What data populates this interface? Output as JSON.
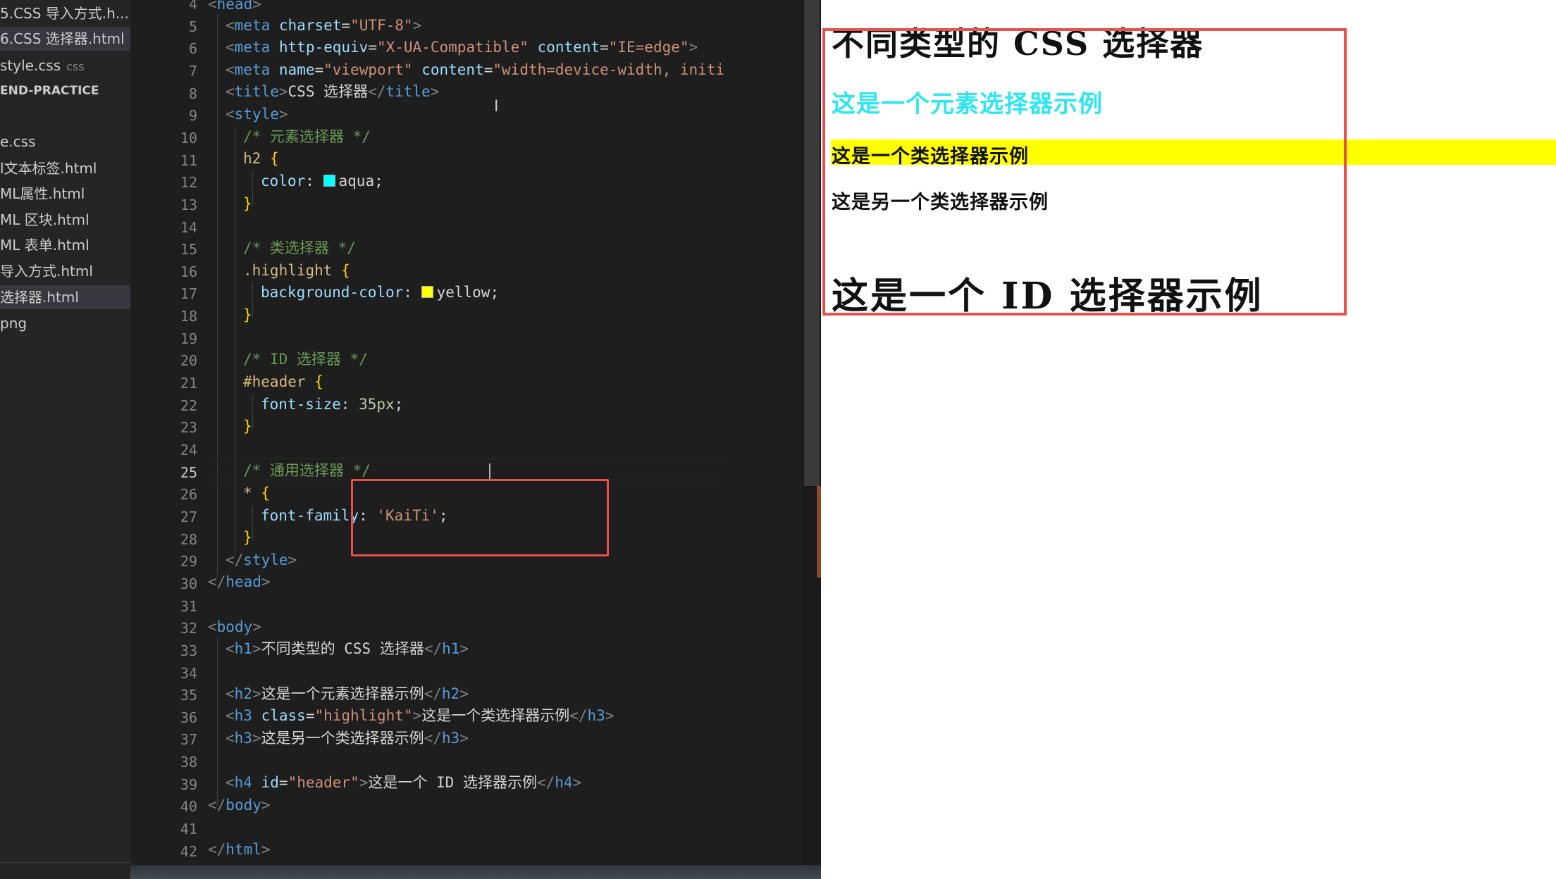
{
  "explorer": {
    "items": [
      {
        "label": "5.CSS 导入方式.h..."
      },
      {
        "label": "6.CSS 选择器.html"
      },
      {
        "label": "style.css",
        "ext": "css"
      },
      {
        "label": "END-PRACTICE"
      },
      {
        "label": "e.css"
      },
      {
        "label": "l文本标签.html"
      },
      {
        "label": "ML属性.html"
      },
      {
        "label": "ML 区块.html"
      },
      {
        "label": "ML 表单.html"
      },
      {
        "label": "导入方式.html"
      },
      {
        "label": "选择器.html"
      },
      {
        "label": "png"
      }
    ]
  },
  "editor": {
    "line_numbers": [
      "4",
      "5",
      "6",
      "7",
      "8",
      "9",
      "10",
      "11",
      "12",
      "13",
      "14",
      "15",
      "16",
      "17",
      "18",
      "19",
      "20",
      "21",
      "22",
      "23",
      "24",
      "25",
      "26",
      "27",
      "28",
      "29",
      "30",
      "31",
      "32",
      "33",
      "34",
      "35",
      "36",
      "37",
      "38",
      "39",
      "40",
      "41",
      "42"
    ],
    "active_line": "25",
    "code": {
      "l4_tag": "head",
      "l5_tag": "meta",
      "l5_attr": "charset",
      "l5_val": "\"UTF-8\"",
      "l6_tag": "meta",
      "l6_attr1": "http-equiv",
      "l6_val1": "\"X-UA-Compatible\"",
      "l6_attr2": "content",
      "l6_val2": "\"IE=edge\"",
      "l7_tag": "meta",
      "l7_attr1": "name",
      "l7_val1": "\"viewport\"",
      "l7_attr2": "content",
      "l7_val2": "\"width=device-width, initi",
      "l8_tag": "title",
      "l8_text": "CSS 选择器",
      "l9_tag": "style",
      "l10_comment": "/* 元素选择器 */",
      "l11_selector": "h2",
      "l12_prop": "color",
      "l12_val": "aqua",
      "l15_comment": "/* 类选择器 */",
      "l16_selector": ".highlight",
      "l17_prop": "background-color",
      "l17_val": "yellow",
      "l20_comment": "/* ID 选择器 */",
      "l21_selector": "#header",
      "l22_prop": "font-size",
      "l22_val": "35px",
      "l25_comment": "/* 通用选择器 */",
      "l26_selector": "*",
      "l27_prop": "font-family",
      "l27_val": "'KaiTi'",
      "l29_tag": "style",
      "l30_tag": "head",
      "l32_tag": "body",
      "l33_tag": "h1",
      "l33_text": "不同类型的 CSS 选择器",
      "l35_tag": "h2",
      "l35_text": "这是一个元素选择器示例",
      "l36_tag": "h3",
      "l36_attr": "class",
      "l36_val": "\"highlight\"",
      "l36_text": "这是一个类选择器示例",
      "l37_tag": "h3",
      "l37_text": "这是另一个类选择器示例",
      "l39_tag": "h4",
      "l39_attr": "id",
      "l39_val": "\"header\"",
      "l39_text": "这是一个 ID 选择器示例",
      "l40_tag": "body",
      "l42_tag": "html"
    },
    "swatch_aqua": "#00ffff",
    "swatch_yellow": "#ffff00"
  },
  "preview": {
    "h1": "不同类型的 CSS 选择器",
    "h2": "这是一个元素选择器示例",
    "h3_highlight": "这是一个类选择器示例",
    "h3": "这是另一个类选择器示例",
    "h4": "这是一个 ID 选择器示例",
    "h2_color": "#00ffff",
    "highlight_color": "#ffff00",
    "annotation_color": "#e8504f"
  }
}
